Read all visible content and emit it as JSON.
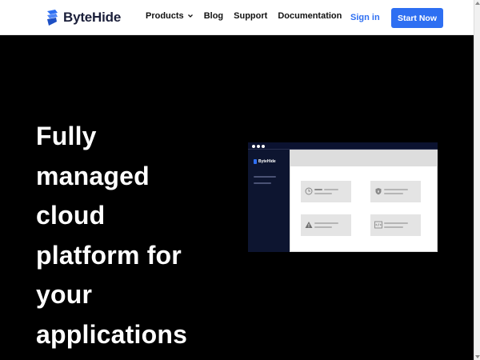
{
  "nav": {
    "brand": "ByteHide",
    "links": [
      {
        "label": "Products",
        "has_dropdown": true
      },
      {
        "label": "Blog"
      },
      {
        "label": "Support"
      },
      {
        "label": "Documentation"
      }
    ],
    "signin_label": "Sign in",
    "cta_label": "Start Now"
  },
  "hero": {
    "title_lines": [
      "Fully",
      "managed",
      "cloud",
      "platform for",
      "your",
      "applications"
    ]
  },
  "illustration": {
    "brand": "ByteHide",
    "cards": [
      {
        "icon": "clock-icon"
      },
      {
        "icon": "shield-icon"
      },
      {
        "icon": "warning-icon"
      },
      {
        "icon": "code-icon"
      }
    ]
  },
  "colors": {
    "accent": "#2e6ff2",
    "hero_bg": "#000000",
    "brand_dark": "#1b1f3a"
  }
}
